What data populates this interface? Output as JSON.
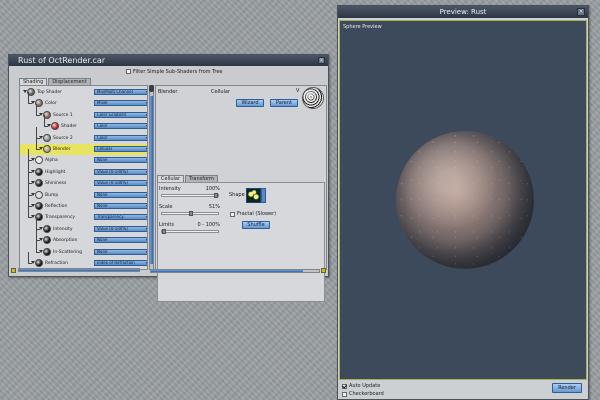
{
  "editor": {
    "title": "Rust of OctRender.car",
    "close_glyph": "×",
    "filter_label": "Filter Simple Sub-Shaders from Tree",
    "filter_checked": false,
    "tabs": [
      "Shading",
      "Displacement"
    ],
    "active_tab": "Shading",
    "tree": [
      {
        "label": "Top Shader",
        "value": "Mix/Multi Channel",
        "level": 0,
        "ball": "#6b5a52",
        "highlight": false
      },
      {
        "label": "Color",
        "value": "Mixer",
        "level": 1,
        "ball": "#7d6a62",
        "highlight": false
      },
      {
        "label": "Source 1",
        "value": "Color Gradient",
        "level": 2,
        "ball": "#8a5d52",
        "highlight": false
      },
      {
        "label": "Shader",
        "value": "Color",
        "level": 3,
        "ball": "#d61a1a",
        "highlight": false
      },
      {
        "label": "Source 2",
        "value": "Color",
        "level": 2,
        "ball": "#8c8c8c",
        "highlight": false
      },
      {
        "label": "Blender",
        "value": "Cellular",
        "level": 2,
        "ball": "#9d9d9d",
        "highlight": true
      },
      {
        "label": "Alpha",
        "value": "None",
        "level": 1,
        "ball": "#eeeeee",
        "highlight": false
      },
      {
        "label": "Highlight",
        "value": "Value (0-100%)",
        "level": 1,
        "ball": "#111111",
        "highlight": false
      },
      {
        "label": "Shininess",
        "value": "Value (0-100%)",
        "level": 1,
        "ball": "#111111",
        "highlight": false
      },
      {
        "label": "Bump",
        "value": "None",
        "level": 1,
        "ball": "#dddddd",
        "highlight": false
      },
      {
        "label": "Reflection",
        "value": "None",
        "level": 1,
        "ball": "#111111",
        "highlight": false
      },
      {
        "label": "Transparency",
        "value": "Transparency",
        "level": 1,
        "ball": "#111111",
        "highlight": false
      },
      {
        "label": "Intensity",
        "value": "Value (0-100%)",
        "level": 2,
        "ball": "#111111",
        "highlight": false
      },
      {
        "label": "Absorption",
        "value": "None",
        "level": 2,
        "ball": "#111111",
        "highlight": false
      },
      {
        "label": "In-Scattering",
        "value": "None",
        "level": 2,
        "ball": "#111111",
        "highlight": false
      },
      {
        "label": "Refraction",
        "value": "Index of Refraction",
        "level": 1,
        "ball": "#111111",
        "highlight": false
      }
    ],
    "panel": {
      "name": "Blender",
      "type": "Cellular",
      "v_mark": "V",
      "wizard_label": "Wizard",
      "parent_label": "Parent",
      "inner_tabs": [
        "Cellular",
        "Transform"
      ],
      "active_inner_tab": "Cellular",
      "params": [
        {
          "label": "Intensity",
          "value": "100%",
          "fraction": 1.0
        },
        {
          "label": "Scale",
          "value": "51%",
          "fraction": 0.51
        },
        {
          "label": "Limits",
          "value": "0 - 100%",
          "fraction": 0.0
        }
      ],
      "shape_label": "Shape",
      "fractal_label": "Fractal (Slower)",
      "fractal_checked": false,
      "shuffle_label": "Shuffle"
    }
  },
  "preview": {
    "title": "Preview: Rust",
    "close_glyph": "×",
    "canvas_label": "Sphere Preview",
    "auto_update_label": "Auto Update",
    "auto_update_checked": true,
    "checkerboard_label": "Checkerboard",
    "checkerboard_checked": false,
    "render_label": "Render"
  }
}
